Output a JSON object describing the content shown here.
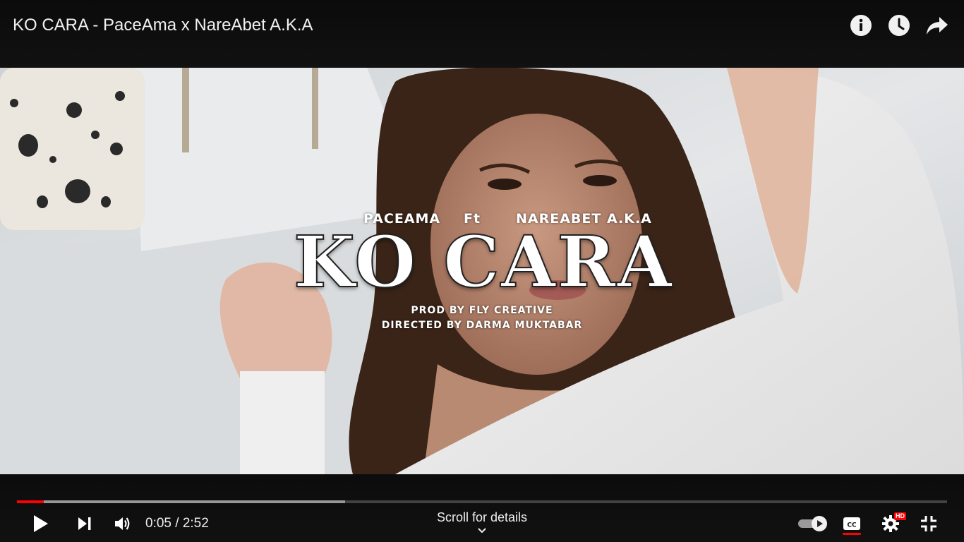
{
  "header": {
    "title": "KO CARA - PaceAma x NareAbet A.K.A",
    "icons": [
      "info-icon",
      "watch-later-icon",
      "share-icon"
    ]
  },
  "video": {
    "overlay": {
      "artist_left": "PACEAMA",
      "featuring": "Ft",
      "artist_right": "NAREABET A.K.A",
      "song_title": "KO CARA",
      "producer_line": "PROD BY FLY CREATIVE",
      "director_line": "DIRECTED BY DARMA MUKTABAR"
    }
  },
  "controls": {
    "current_time": "0:05",
    "duration": "2:52",
    "time_text": "0:05 / 2:52",
    "played_fraction": 0.029,
    "buffered_fraction": 0.353,
    "scroll_hint": "Scroll for details",
    "autoplay_on": true,
    "captions_on": true,
    "hd_badge": "HD",
    "colors": {
      "progress_played": "#ff0000",
      "hd_badge": "#ff0000"
    }
  }
}
